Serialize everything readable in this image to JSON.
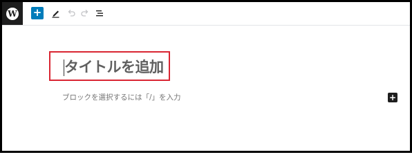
{
  "toolbar": {
    "logo_icon": "wordpress-logo-icon",
    "add_block_icon": "plus-icon",
    "tools_icon": "pencil-icon",
    "undo_icon": "undo-icon",
    "redo_icon": "redo-icon",
    "list_view_icon": "list-view-icon"
  },
  "editor": {
    "title_placeholder": "タイトルを追加",
    "block_hint": "ブロックを選択するには「/」を入力",
    "inserter_icon": "plus-icon"
  },
  "colors": {
    "accent": "#007cba",
    "highlight_border": "#d92532",
    "logo_background": "#1e1e1e"
  }
}
